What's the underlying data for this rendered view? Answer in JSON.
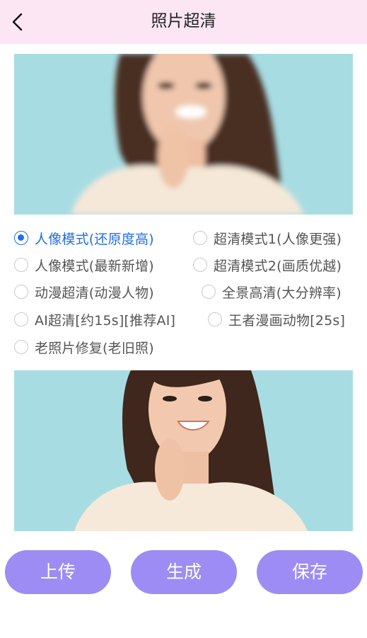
{
  "header": {
    "title": "照片超清"
  },
  "options": [
    {
      "label": "人像模式(还原度高)",
      "checked": true
    },
    {
      "label": "超清模式1(人像更强)",
      "checked": false
    },
    {
      "label": "人像模式(最新新增)",
      "checked": false
    },
    {
      "label": "超清模式2(画质优越)",
      "checked": false
    },
    {
      "label": "动漫超清(动漫人物)",
      "checked": false
    },
    {
      "label": "全景高清(大分辨率)",
      "checked": false
    },
    {
      "label": "AI超清[约15s][推荐AI]",
      "checked": false
    },
    {
      "label": "王者漫画动物[25s]",
      "checked": false
    },
    {
      "label": "老照片修复(老旧照)",
      "checked": false
    }
  ],
  "buttons": {
    "upload": "上传",
    "generate": "生成",
    "save": "保存"
  },
  "colors": {
    "header_bg": "#fde6f4",
    "accent": "#1e6fe8",
    "button_bg": "#9c8cf3"
  }
}
